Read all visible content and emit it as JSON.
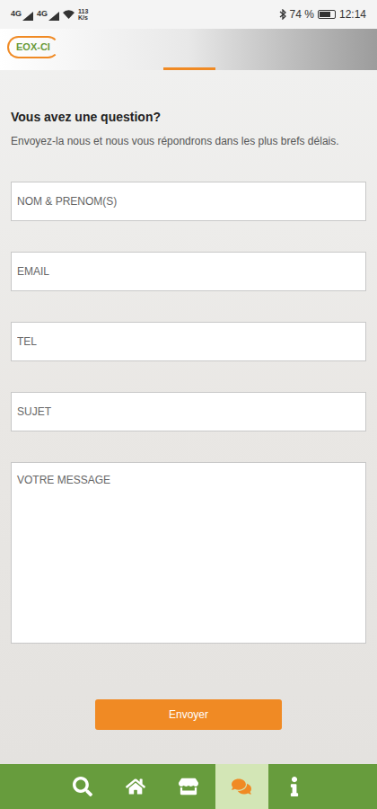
{
  "status_bar": {
    "network": [
      "4G",
      "4G"
    ],
    "speed": [
      "113",
      "K/s"
    ],
    "battery": "74 %",
    "time": "12:14"
  },
  "header": {
    "logo": "EOX-CI"
  },
  "form": {
    "title": "Vous avez une question?",
    "subtitle": "Envoyez-la nous et nous vous répondrons dans les plus brefs délais.",
    "fields": [
      {
        "placeholder": "NOM & PRENOM(S)",
        "kind": "input"
      },
      {
        "placeholder": "EMAIL",
        "kind": "input"
      },
      {
        "placeholder": "TEL",
        "kind": "input"
      },
      {
        "placeholder": "SUJET",
        "kind": "input"
      },
      {
        "placeholder": "VOTRE MESSAGE",
        "kind": "textarea"
      }
    ],
    "submit": "Envoyer"
  },
  "nav": [
    {
      "selected": false
    },
    {
      "selected": false
    },
    {
      "selected": false
    },
    {
      "selected": true
    },
    {
      "selected": false
    }
  ]
}
